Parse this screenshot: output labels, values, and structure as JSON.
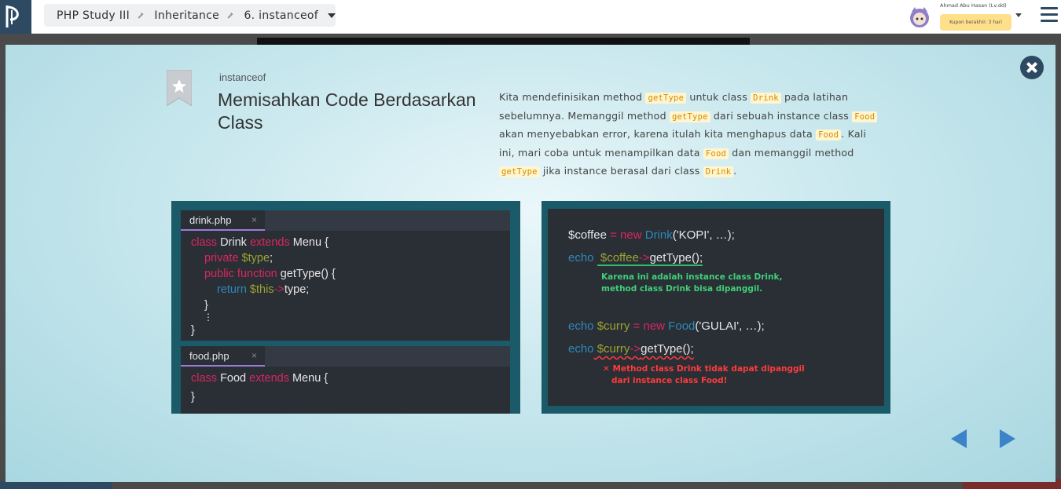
{
  "colors": {
    "accent": "#2e4a62",
    "kw_fg": "#d48b00",
    "kw_bg": "#fff6d0",
    "nav": "#3a84c7",
    "panel": "#1b5a68",
    "editor_bg": "#2a2e35"
  },
  "breadcrumb": {
    "items": [
      "PHP Study III",
      "Inheritance",
      "6. instanceof"
    ]
  },
  "user": {
    "name": "Ahmad Abu Hasan (Lv.dd)",
    "coupon": "Kupon berakhir: 3 hari"
  },
  "lesson": {
    "kicker": "instanceof",
    "title": "Memisahkan Code Berdasarkan Class",
    "desc": {
      "t1": "Kita mendefinisikan method ",
      "k1": "getType",
      "t2": " untuk class ",
      "k2": "Drink",
      "t3": " pada latihan sebelumnya. Memanggil method ",
      "k3": "getType",
      "t4": " dari sebuah instance class ",
      "k4": "Food",
      "t5": " akan menyebabkan error, karena itulah kita menghapus data ",
      "k5": "Food",
      "t6": ". Kali ini, mari coba untuk menampilkan data ",
      "k6": "Food",
      "t7": " dan memanggil method ",
      "k7": "getType",
      "t8": " jika instance berasal dari class ",
      "k8": "Drink",
      "t9": "."
    }
  },
  "drink_editor": {
    "tab": "drink.php",
    "close": "×",
    "l1": {
      "a": "class",
      "b": " Drink ",
      "c": "extends",
      "d": " Menu {"
    },
    "l2": {
      "a": "private",
      "b": " $type",
      "c": ";"
    },
    "l3": {
      "a": "public",
      "b": " function",
      "c": " getType() {"
    },
    "l4": {
      "a": "return",
      "b": " $this",
      "c": "->",
      "d": "type;"
    },
    "l5": "}",
    "l6": "⋮",
    "l7": "}"
  },
  "food_editor": {
    "tab": "food.php",
    "close": "×",
    "l1": {
      "a": "class",
      "b": " Food ",
      "c": "extends",
      "d": " Menu {"
    },
    "l2": "}"
  },
  "console": {
    "c1": {
      "a": "$coffee",
      "b": " = ",
      "c": "new",
      "d": " Drink",
      "e": "('KOPI', …);"
    },
    "c2": {
      "a": "echo",
      "b": " $coffee",
      "c": "->",
      "d": "getType();"
    },
    "ok_note": "Karena ini adalah instance class Drink,\nmethod class Drink bisa dipanggil.",
    "c3": {
      "a": "echo",
      "b": " $curry",
      "c": " = ",
      "d": "new",
      "e": " Food",
      "f": "('GULAI', …);"
    },
    "c4": {
      "a": "echo",
      "b": " $curry",
      "c": "->",
      "d": "getType();"
    },
    "err_note": "✕ Method class Drink tidak dapat dipanggil\n   dari instance class Food!"
  }
}
